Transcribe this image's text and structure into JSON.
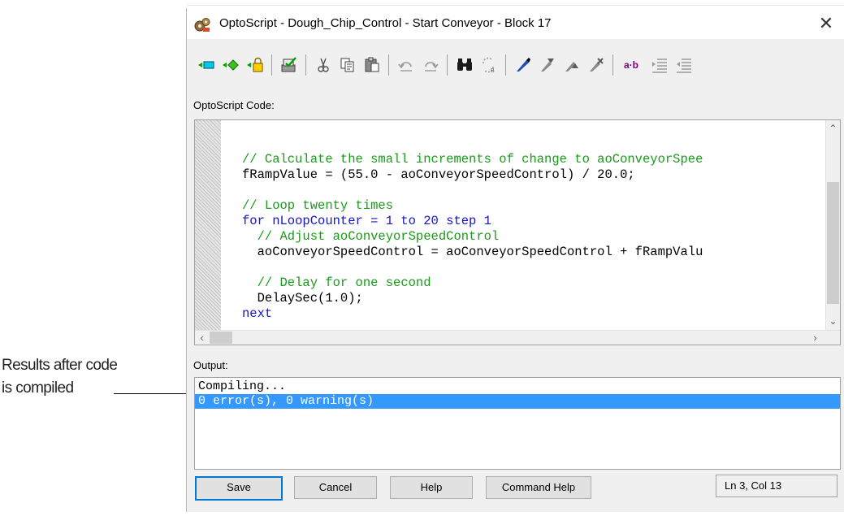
{
  "callout": {
    "line1": "Results after code",
    "line2": "is compiled"
  },
  "window": {
    "title": "OptoScript - Dough_Chip_Control - Start Conveyor - Block 17",
    "close": "✕"
  },
  "toolbar": {
    "icons": [
      "insert-variable-icon",
      "insert-instruction-icon",
      "insert-command-icon",
      "compile-icon",
      "cut-icon",
      "copy-icon",
      "paste-icon",
      "undo-icon",
      "redo-icon",
      "find-icon",
      "replace-icon",
      "bookmark-icon",
      "prev-bookmark-icon",
      "next-bookmark-icon",
      "clear-bookmarks-icon",
      "text-format-icon",
      "indent-icon",
      "outdent-icon"
    ],
    "text_format_label": "a·b"
  },
  "code_section": {
    "label": "OptoScript Code:",
    "lines": [
      "// Calculate the small increments of change to aoConveyorSpee",
      "fRampValue = (55.0 - aoConveyorSpeedControl) / 20.0;",
      "",
      "// Loop twenty times",
      "for nLoopCounter = 1 to 20 step 1",
      "  // Adjust aoConveyorSpeedControl",
      "  aoConveyorSpeedControl = aoConveyorSpeedControl + fRampValu",
      "",
      "  // Delay for one second",
      "  DelaySec(1.0);",
      "next"
    ]
  },
  "output_section": {
    "label": "Output:",
    "lines": [
      "Compiling...",
      "0 error(s), 0 warning(s)"
    ],
    "selected_index": 1
  },
  "buttons": {
    "save": "Save",
    "cancel": "Cancel",
    "help": "Help",
    "command_help": "Command Help"
  },
  "status": {
    "position": "Ln 3, Col 13"
  },
  "colors": {
    "selection": "#3399ff",
    "comment": "#1a9a1a",
    "keyword": "#1515c8"
  }
}
